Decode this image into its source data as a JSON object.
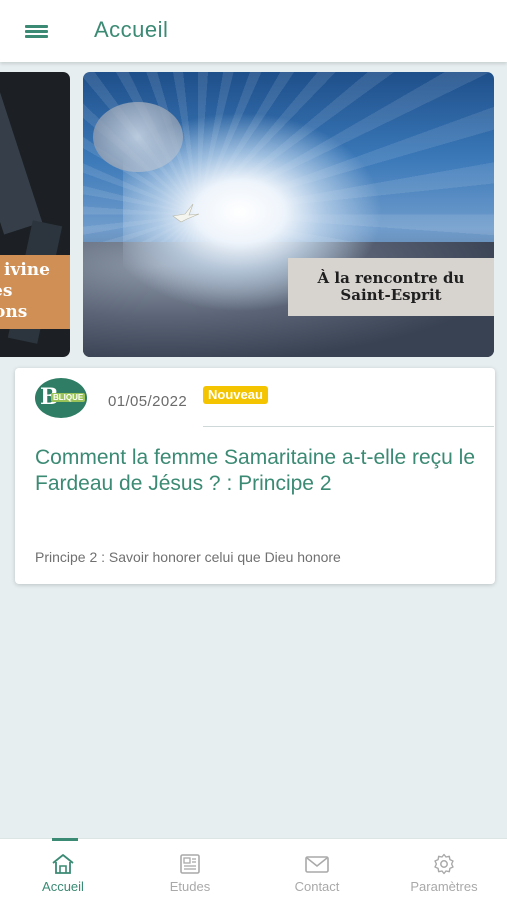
{
  "appbar": {
    "title": "Accueil",
    "menu_icon": "menu-icon"
  },
  "carousel": {
    "left_slide": {
      "lines": [
        "ivine",
        "es",
        "ons"
      ]
    },
    "main_slide": {
      "caption_line1": "À la rencontre du",
      "caption_line2": "Saint-Esprit"
    }
  },
  "card": {
    "avatar_letter": "B",
    "avatar_tag": "BLIQUE",
    "date": "01/05/2022",
    "badge": "Nouveau",
    "title": "Comment la femme Samaritaine a-t-elle reçu le Fardeau de Jésus ? : Principe 2",
    "subtitle": "Principe 2 : Savoir honorer celui que Dieu honore"
  },
  "bottom_nav": {
    "items": [
      {
        "label": "Accueil",
        "icon": "home-icon",
        "active": true
      },
      {
        "label": "Etudes",
        "icon": "newspaper-icon",
        "active": false
      },
      {
        "label": "Contact",
        "icon": "mail-icon",
        "active": false
      },
      {
        "label": "Paramètres",
        "icon": "gear-icon",
        "active": false
      }
    ]
  },
  "colors": {
    "accent": "#3b8a73",
    "badge": "#f4c400",
    "background": "#e6eeef"
  }
}
